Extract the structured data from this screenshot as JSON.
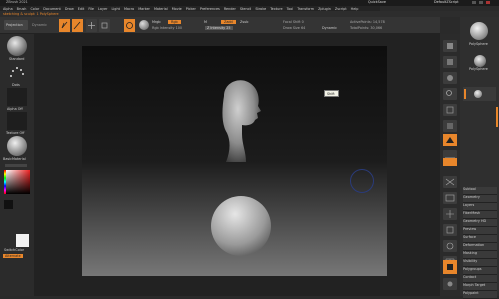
{
  "titlebar": {
    "app_title": "ZBrush 2021",
    "center_label": "QuickSave",
    "right_label": "DefaultZScript",
    "menu_items": [
      "Alpha",
      "Brush",
      "Color",
      "Document",
      "Draw",
      "Edit",
      "File",
      "Layer",
      "Light",
      "Macro",
      "Marker",
      "Material",
      "Movie",
      "Picker",
      "Preferences",
      "Render",
      "Stencil",
      "Stroke",
      "Texture",
      "Tool",
      "Transform",
      "Zplugin",
      "Zscript",
      "Help"
    ]
  },
  "subbar": {
    "path": "sketching & sculpt: 1  PolySphere"
  },
  "toolbar": {
    "buttons": [
      "Edit",
      "Draw",
      "Move",
      "Scale",
      "Rotate"
    ],
    "mrgb": "Mrgb",
    "rgb": "Rgb",
    "m": "M",
    "zadd": "Zadd",
    "zsub": "Zsub",
    "focal_shift_label": "Focal Shift 0",
    "draw_size_label": "Draw Size 64",
    "rgb_intensity_label": "Rgb Intensity 100",
    "z_intensity_label": "Z Intensity 25",
    "dynamic": "Dynamic",
    "active_points": "ActivePoints: 14,578",
    "total_points": "TotalPoints: 30,066"
  },
  "left_panel": {
    "projection_label": "Projection",
    "brush_label": "Standard",
    "stroke_label": "Dots",
    "alpha_label": "Alpha Off",
    "texture_label": "Texture Off",
    "material_label": "BasicMaterial",
    "gradient_label": "Gradient",
    "switch_label": "SwitchColor",
    "alternate_label": "Alternate"
  },
  "canvas": {
    "tooltip": "Shift",
    "bg_top": "#111111",
    "bg_bottom": "#888888"
  },
  "right_panel": {
    "tool_name": "PolySphere",
    "subtool_name": "PolySphere",
    "buttons": [
      "BPR",
      "SPix 3",
      "Scroll",
      "Zoom",
      "Actual",
      "AAHalf",
      "Persp",
      "Floor",
      "L.Sym",
      "Xyz",
      "Frame",
      "Move",
      "Scale",
      "Rotate",
      "PolyF",
      "Transp",
      "Ghost",
      "Solo"
    ],
    "subtool_list_items": [
      "Subtool",
      "Geometry",
      "Layers",
      "FiberMesh",
      "Geometry HD",
      "Preview",
      "Surface",
      "Deformation",
      "Masking",
      "Visibility",
      "Polygroups",
      "Contact",
      "Morph Target",
      "Polypaint",
      "UV Map",
      "Texture Map",
      "Displacement",
      "Normal Map",
      "Vector Displace",
      "Unified Skin",
      "Initialize",
      "Import",
      "Export"
    ]
  },
  "colors": {
    "accent": "#e8862b",
    "panel": "#2b2b2b",
    "toolbar": "#343434"
  }
}
